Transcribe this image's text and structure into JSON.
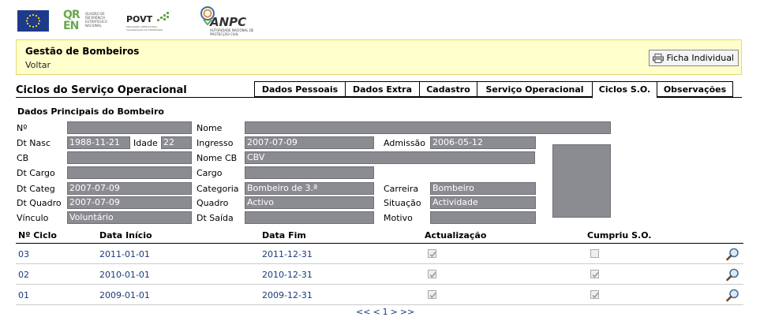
{
  "logos": {
    "qren_text": "QUADRO DE REFERÊNCIA ESTRATÉGICO NACIONAL",
    "povt": "POVT",
    "povt_sub": "PROGRAMA OPERACIONAL VALORIZAÇÃO DO TERRITÓRIO",
    "anpc": "ANPC",
    "anpc_sub": "AUTORIDADE NACIONAL DE PROTECÇÃO CIVIL"
  },
  "header": {
    "title": "Gestão de Bombeiros",
    "back": "Voltar",
    "print_button": "Ficha Individual"
  },
  "section_title": "Ciclos do Serviço Operacional",
  "tabs": [
    "Dados Pessoais",
    "Dados Extra",
    "Cadastro",
    "Serviço Operacional",
    "Ciclos S.O.",
    "Observações"
  ],
  "active_tab": "Ciclos S.O.",
  "subheading": "Dados Principais do Bombeiro",
  "fields": {
    "numero_label": "Nº",
    "numero": "",
    "nome_label": "Nome",
    "nome": "",
    "dt_nasc_label": "Dt Nasc",
    "dt_nasc": "1988-11-21",
    "idade_label": "Idade",
    "idade": "22",
    "ingresso_label": "Ingresso",
    "ingresso": "2007-07-09",
    "admissao_label": "Admissão",
    "admissao": "2006-05-12",
    "cb_label": "CB",
    "cb": "",
    "nome_cb_label": "Nome CB",
    "nome_cb": "CBV",
    "dt_cargo_label": "Dt Cargo",
    "dt_cargo": "",
    "cargo_label": "Cargo",
    "cargo": "",
    "dt_categ_label": "Dt Categ",
    "dt_categ": "2007-07-09",
    "categoria_label": "Categoria",
    "categoria": "Bombeiro de 3.ª",
    "carreira_label": "Carreira",
    "carreira": "Bombeiro",
    "dt_quadro_label": "Dt Quadro",
    "dt_quadro": "2007-07-09",
    "quadro_label": "Quadro",
    "quadro": "Activo",
    "situacao_label": "Situação",
    "situacao": "Actividade",
    "vinculo_label": "Vínculo",
    "vinculo": "Voluntário",
    "dt_saida_label": "Dt Saída",
    "dt_saida": "",
    "motivo_label": "Motivo",
    "motivo": ""
  },
  "grid": {
    "headers": [
      "Nº Ciclo",
      "Data Início",
      "Data Fim",
      "Actualização",
      "Cumpriu S.O."
    ],
    "rows": [
      {
        "ciclo": "03",
        "inicio": "2011-01-01",
        "fim": "2011-12-31",
        "actualizacao": true,
        "cumpriu": false
      },
      {
        "ciclo": "02",
        "inicio": "2010-01-01",
        "fim": "2010-12-31",
        "actualizacao": true,
        "cumpriu": true
      },
      {
        "ciclo": "01",
        "inicio": "2009-01-01",
        "fim": "2009-12-31",
        "actualizacao": true,
        "cumpriu": true
      }
    ]
  },
  "pager": {
    "first": "<<",
    "prev": "<",
    "page": "1",
    "next": ">",
    "last": ">>"
  },
  "colors": {
    "header_bg": "#ffffcc",
    "field_bg": "#8b8b92",
    "link": "#1a3a7a"
  }
}
